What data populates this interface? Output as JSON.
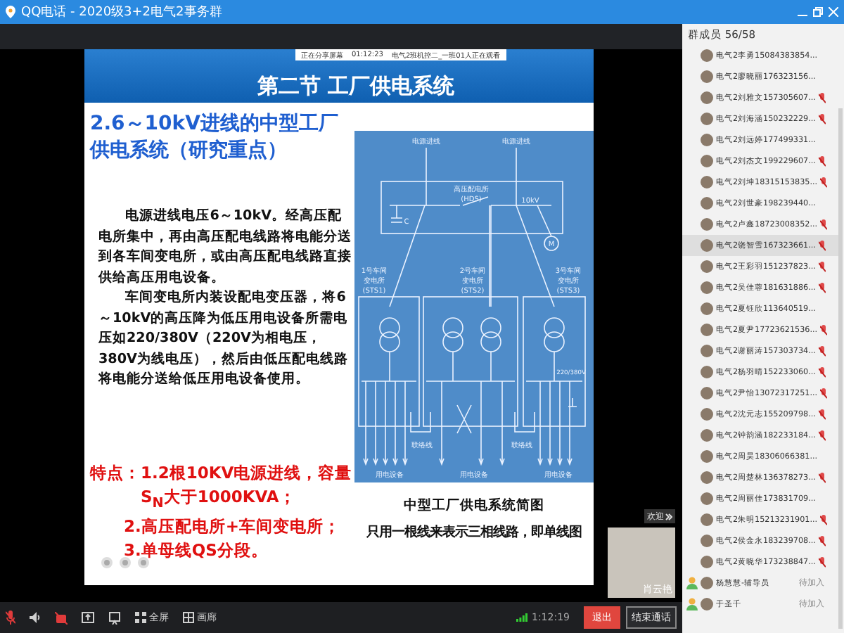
{
  "window": {
    "title": "QQ电话 - 2020级3+2电气2事务群"
  },
  "share_notice": [
    "正在分享屏幕",
    "01:12:23",
    "电气2班机控二_一班01人正在观看"
  ],
  "slide": {
    "header": "第二节 工厂供电系统",
    "title": "2.6～10kV进线的中型工厂供电系统（研究重点）",
    "paragraphs": [
      "电源进线电压6～10kV。经高压配电所集中，再由高压配电线路将电能分送到各车间变电所，或由高压配电线路直接供给高压用电设备。",
      "车间变电所内装设配电变压器，将6～10kV的高压降为低压用电设备所需电压如220/380V（220V为相电压，380V为线电压），然后由低压配电线路将电能分送给低压用电设备使用。"
    ],
    "features": {
      "label": "特点：",
      "items": [
        "1.2根10KV电源进线，容量S$_{N}$大于1000KVA；",
        "2.高压配电所+车间变电所；",
        "3.单母线QS分段。"
      ]
    },
    "diagram": {
      "incoming": [
        "电源进线",
        "电源进线"
      ],
      "hds": "高压配电所",
      "hds_code": "(HDS)",
      "voltage": "10kV",
      "capacitor": "C",
      "motor": "M",
      "substations": [
        {
          "name": "1号车间",
          "name2": "变电所",
          "code": "(STS1)"
        },
        {
          "name": "2号车间",
          "name2": "变电所",
          "code": "(STS2)"
        },
        {
          "name": "3号车间",
          "name2": "变电所",
          "code": "(STS3)"
        }
      ],
      "lv_voltage": "220/380V",
      "tie_lines": [
        "联络线",
        "联络线"
      ],
      "loads": [
        "用电设备",
        "用电设备",
        "用电设备"
      ]
    },
    "captions": [
      "中型工厂供电系统简图",
      "只用一根线来表示三相线路，即单线图"
    ]
  },
  "camera": {
    "welcome": "欢迎",
    "name": "肖云艳"
  },
  "toolbar": {
    "buttons": [
      {
        "kind": "mic",
        "off": true
      },
      {
        "kind": "speaker",
        "off": false
      },
      {
        "kind": "camera",
        "off": true
      },
      {
        "kind": "share",
        "off": false
      },
      {
        "kind": "board",
        "off": false
      },
      {
        "kind": "fullscreen",
        "off": false,
        "label": "全屏"
      },
      {
        "kind": "gallery",
        "off": false,
        "label": "画廊"
      }
    ],
    "duration": "1:12:19",
    "exit": "退出",
    "end": "结束通话"
  },
  "members_panel": {
    "title": "群成员 56/58",
    "members": [
      {
        "kind": "member",
        "name": "电气2李勇15084383854...",
        "muted": false,
        "selected": false
      },
      {
        "kind": "member",
        "name": "电气2廖晓丽176323156...",
        "muted": false,
        "selected": false
      },
      {
        "kind": "member",
        "name": "电气2刘雅文157305607...",
        "muted": true,
        "selected": false
      },
      {
        "kind": "member",
        "name": "电气2刘海涵150232229...",
        "muted": true,
        "selected": false
      },
      {
        "kind": "member",
        "name": "电气2刘远婷177499331...",
        "muted": false,
        "selected": false
      },
      {
        "kind": "member",
        "name": "电气2刘杰文199229607...",
        "muted": true,
        "selected": false
      },
      {
        "kind": "member",
        "name": "电气2刘坤18315153835...",
        "muted": true,
        "selected": false
      },
      {
        "kind": "member",
        "name": "电气2刘世豪198239440...",
        "muted": false,
        "selected": false
      },
      {
        "kind": "member",
        "name": "电气2卢鑫18723008352...",
        "muted": true,
        "selected": false
      },
      {
        "kind": "member",
        "name": "电气2饶智雪167323661...",
        "muted": true,
        "selected": true
      },
      {
        "kind": "member",
        "name": "电气2王彩羽151237823...",
        "muted": true,
        "selected": false
      },
      {
        "kind": "member",
        "name": "电气2吴佳蓉181631886...",
        "muted": true,
        "selected": false
      },
      {
        "kind": "member",
        "name": "电气2夏钰欣113640519...",
        "muted": false,
        "selected": false
      },
      {
        "kind": "member",
        "name": "电气2夏尹17723621536...",
        "muted": true,
        "selected": false
      },
      {
        "kind": "member",
        "name": "电气2谢丽涛157303734...",
        "muted": true,
        "selected": false
      },
      {
        "kind": "member",
        "name": "电气2杨羽晴152233060...",
        "muted": true,
        "selected": false
      },
      {
        "kind": "member",
        "name": "电气2尹怡13072317251...",
        "muted": true,
        "selected": false
      },
      {
        "kind": "member",
        "name": "电气2沈元志155209798...",
        "muted": true,
        "selected": false
      },
      {
        "kind": "member",
        "name": "电气2钟韵涵182233184...",
        "muted": true,
        "selected": false
      },
      {
        "kind": "member",
        "name": "电气2周昊18306066381...",
        "muted": false,
        "selected": false
      },
      {
        "kind": "member",
        "name": "电气2周楚林136378273...",
        "muted": true,
        "selected": false
      },
      {
        "kind": "member",
        "name": "电气2周丽佳173831709...",
        "muted": false,
        "selected": false
      },
      {
        "kind": "member",
        "name": "电气2朱明15213231901...",
        "muted": true,
        "selected": false
      },
      {
        "kind": "member",
        "name": "电气2侯金永183239708...",
        "muted": true,
        "selected": false
      },
      {
        "kind": "member",
        "name": "电气2黄晓华173238847...",
        "muted": true,
        "selected": false
      },
      {
        "kind": "pending",
        "name": "杨慧慧-辅导员",
        "status": "待加入",
        "selected": false
      },
      {
        "kind": "pending",
        "name": "于圣千",
        "status": "待加入",
        "selected": false
      }
    ]
  }
}
